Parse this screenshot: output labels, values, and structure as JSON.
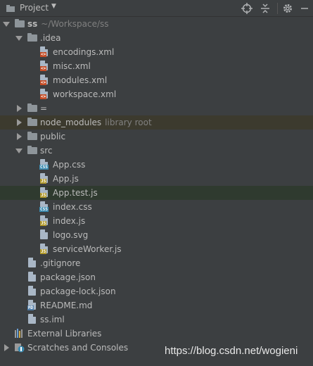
{
  "toolbar": {
    "title": "Project",
    "caret": "▼",
    "icons": [
      "crosshair-icon",
      "collapse-icon",
      "gear-icon",
      "hide-icon"
    ]
  },
  "tree": {
    "root": {
      "name": "ss",
      "path": "~/Workspace/ss"
    },
    "idea": {
      "name": ".idea",
      "files": [
        "encodings.xml",
        "misc.xml",
        "modules.xml",
        "workspace.xml"
      ]
    },
    "eq_folder": "=",
    "node_modules": {
      "name": "node_modules",
      "hint": "library root"
    },
    "public": "public",
    "src": {
      "name": "src",
      "files": [
        "App.css",
        "App.js",
        "App.test.js",
        "index.css",
        "index.js",
        "logo.svg",
        "serviceWorker.js"
      ]
    },
    "root_files": [
      ".gitignore",
      "package.json",
      "package-lock.json",
      "README.md",
      "ss.iml"
    ],
    "external_libraries": "External Libraries",
    "scratches": "Scratches and Consoles"
  },
  "badges": {
    "xml": "<>",
    "css": "CSS",
    "js": "JS",
    "md": "MD"
  },
  "colors": {
    "background": "#3c3f41",
    "text": "#bbbbbb",
    "hint": "#808080",
    "xml_badge": "#c44d27",
    "css_badge": "#3c8bb0",
    "js_badge": "#b29a2c",
    "md_badge": "#4a7aa8"
  },
  "watermark": "https://blog.csdn.net/wogieni"
}
